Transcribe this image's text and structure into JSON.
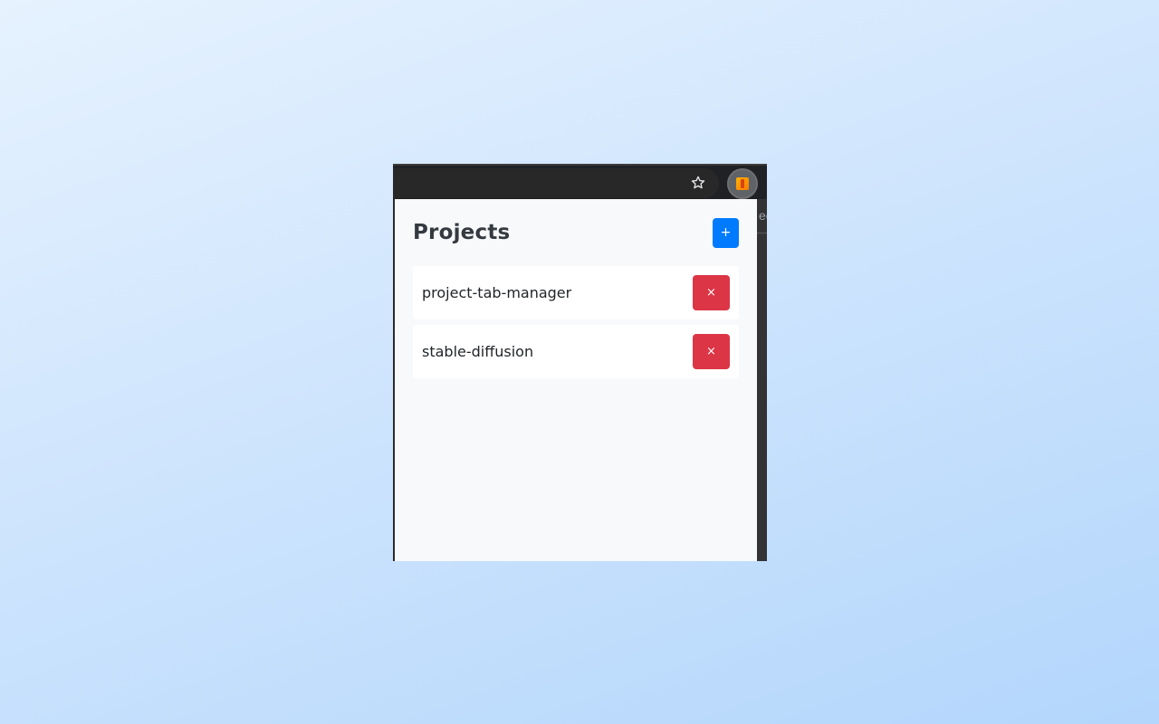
{
  "browser": {
    "star_icon": "star-outline-icon",
    "extension_icon": "project-tab-manager-extension-icon",
    "background_peek_text": "ec"
  },
  "popup": {
    "title": "Projects",
    "add_label": "+",
    "delete_label": "×",
    "projects": [
      {
        "name": "project-tab-manager"
      },
      {
        "name": "stable-diffusion"
      }
    ]
  },
  "colors": {
    "primary": "#007bff",
    "danger": "#dc3545",
    "popup_background": "#f8f9fa",
    "card_background": "#ffffff",
    "title_text": "#343a40",
    "browser_chrome": "#202124"
  }
}
